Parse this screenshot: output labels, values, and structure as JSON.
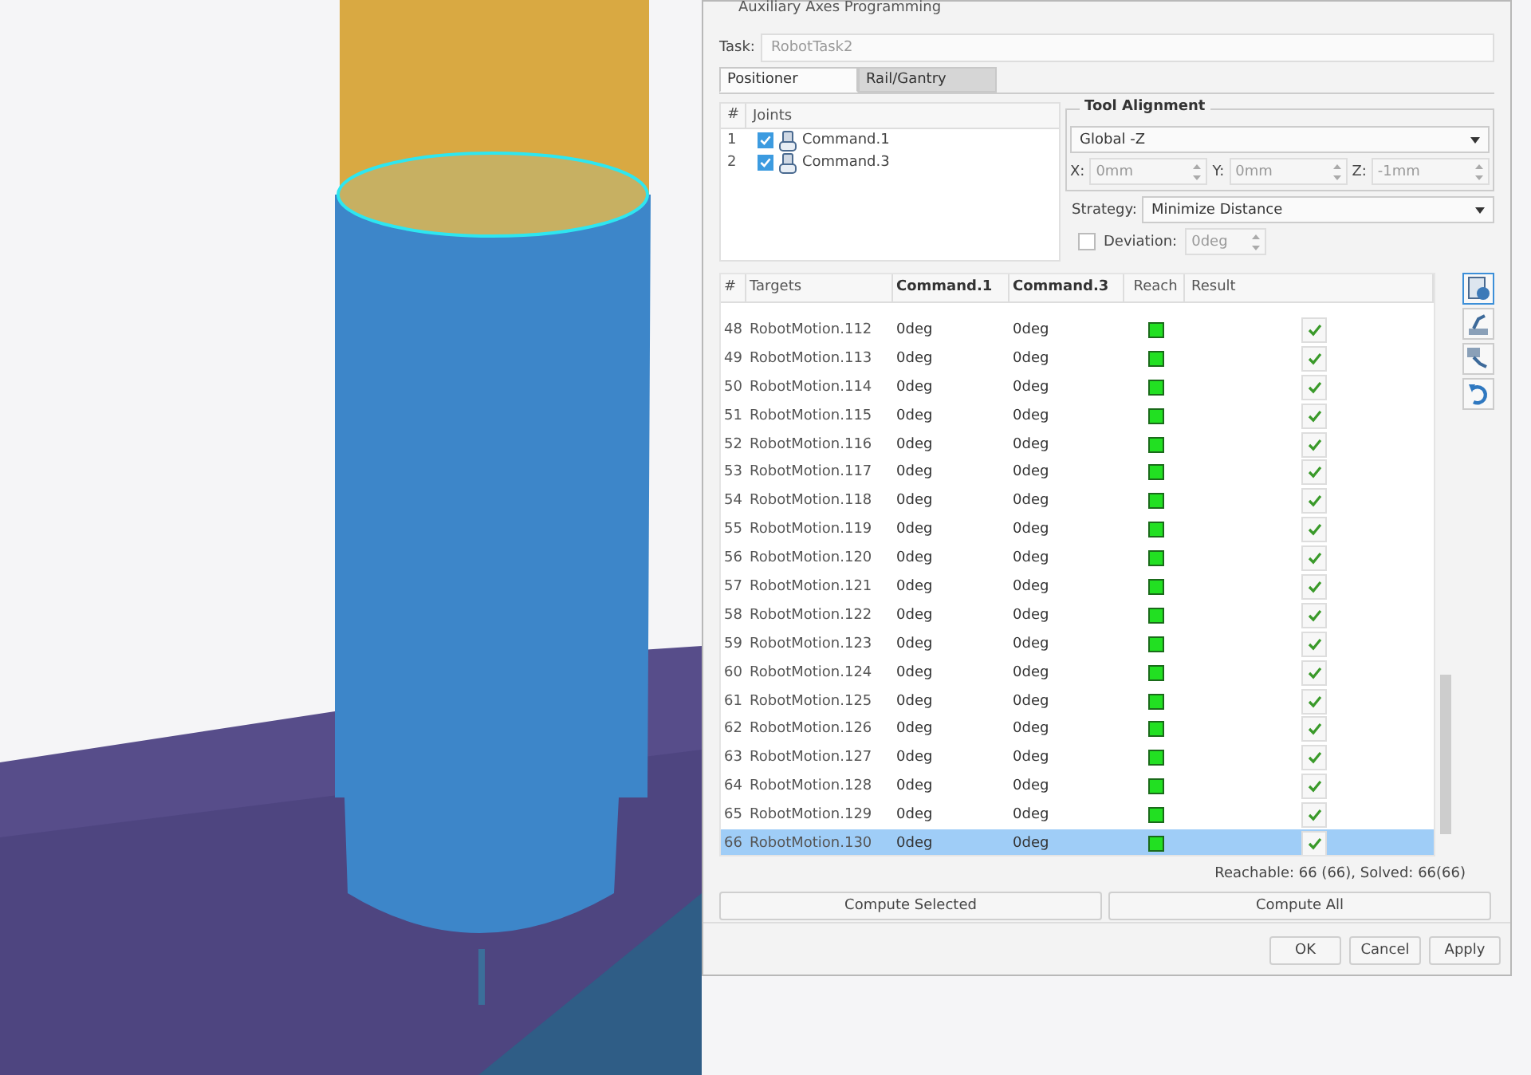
{
  "window": {
    "title": "Auxiliary Axes Programming"
  },
  "task": {
    "label": "Task:",
    "value": "RobotTask2"
  },
  "tabs": [
    {
      "label": "Positioner",
      "selected": true
    },
    {
      "label": "Rail/Gantry",
      "selected": false
    }
  ],
  "joints": {
    "columns": [
      "#",
      "Joints"
    ],
    "rows": [
      {
        "index": "1",
        "name": "Command.1",
        "checked": true
      },
      {
        "index": "2",
        "name": "Command.3",
        "checked": true
      }
    ]
  },
  "tool_alignment": {
    "title": "Tool Alignment",
    "mode": "Global -Z",
    "fields": [
      {
        "label": "X:",
        "value": "0mm"
      },
      {
        "label": "Y:",
        "value": "0mm"
      },
      {
        "label": "Z:",
        "value": "-1mm"
      }
    ],
    "strategy_label": "Strategy:",
    "strategy": "Minimize Distance",
    "deviation": {
      "label": "Deviation:",
      "checked": false,
      "value": "0deg"
    }
  },
  "targets": {
    "columns": [
      "#",
      "Targets",
      "Command.1",
      "Command.3",
      "Reach",
      "Result"
    ],
    "rows": [
      {
        "index": "48",
        "target": "RobotMotion.112",
        "command_1": "0deg",
        "command_3": "0deg",
        "reachable": true,
        "solved": true,
        "selected": false
      },
      {
        "index": "49",
        "target": "RobotMotion.113",
        "command_1": "0deg",
        "command_3": "0deg",
        "reachable": true,
        "solved": true,
        "selected": false
      },
      {
        "index": "50",
        "target": "RobotMotion.114",
        "command_1": "0deg",
        "command_3": "0deg",
        "reachable": true,
        "solved": true,
        "selected": false
      },
      {
        "index": "51",
        "target": "RobotMotion.115",
        "command_1": "0deg",
        "command_3": "0deg",
        "reachable": true,
        "solved": true,
        "selected": false
      },
      {
        "index": "52",
        "target": "RobotMotion.116",
        "command_1": "0deg",
        "command_3": "0deg",
        "reachable": true,
        "solved": true,
        "selected": false
      },
      {
        "index": "53",
        "target": "RobotMotion.117",
        "command_1": "0deg",
        "command_3": "0deg",
        "reachable": true,
        "solved": true,
        "selected": false
      },
      {
        "index": "54",
        "target": "RobotMotion.118",
        "command_1": "0deg",
        "command_3": "0deg",
        "reachable": true,
        "solved": true,
        "selected": false
      },
      {
        "index": "55",
        "target": "RobotMotion.119",
        "command_1": "0deg",
        "command_3": "0deg",
        "reachable": true,
        "solved": true,
        "selected": false
      },
      {
        "index": "56",
        "target": "RobotMotion.120",
        "command_1": "0deg",
        "command_3": "0deg",
        "reachable": true,
        "solved": true,
        "selected": false
      },
      {
        "index": "57",
        "target": "RobotMotion.121",
        "command_1": "0deg",
        "command_3": "0deg",
        "reachable": true,
        "solved": true,
        "selected": false
      },
      {
        "index": "58",
        "target": "RobotMotion.122",
        "command_1": "0deg",
        "command_3": "0deg",
        "reachable": true,
        "solved": true,
        "selected": false
      },
      {
        "index": "59",
        "target": "RobotMotion.123",
        "command_1": "0deg",
        "command_3": "0deg",
        "reachable": true,
        "solved": true,
        "selected": false
      },
      {
        "index": "60",
        "target": "RobotMotion.124",
        "command_1": "0deg",
        "command_3": "0deg",
        "reachable": true,
        "solved": true,
        "selected": false
      },
      {
        "index": "61",
        "target": "RobotMotion.125",
        "command_1": "0deg",
        "command_3": "0deg",
        "reachable": true,
        "solved": true,
        "selected": false
      },
      {
        "index": "62",
        "target": "RobotMotion.126",
        "command_1": "0deg",
        "command_3": "0deg",
        "reachable": true,
        "solved": true,
        "selected": false
      },
      {
        "index": "63",
        "target": "RobotMotion.127",
        "command_1": "0deg",
        "command_3": "0deg",
        "reachable": true,
        "solved": true,
        "selected": false
      },
      {
        "index": "64",
        "target": "RobotMotion.128",
        "command_1": "0deg",
        "command_3": "0deg",
        "reachable": true,
        "solved": true,
        "selected": false
      },
      {
        "index": "65",
        "target": "RobotMotion.129",
        "command_1": "0deg",
        "command_3": "0deg",
        "reachable": true,
        "solved": true,
        "selected": false
      },
      {
        "index": "66",
        "target": "RobotMotion.130",
        "command_1": "0deg",
        "command_3": "0deg",
        "reachable": true,
        "solved": true,
        "selected": true
      }
    ]
  },
  "summary": "Reachable: 66 (66), Solved: 66(66)",
  "compute_buttons": [
    "Compute Selected",
    "Compute All"
  ],
  "buttons": [
    "OK",
    "Cancel",
    "Apply"
  ]
}
